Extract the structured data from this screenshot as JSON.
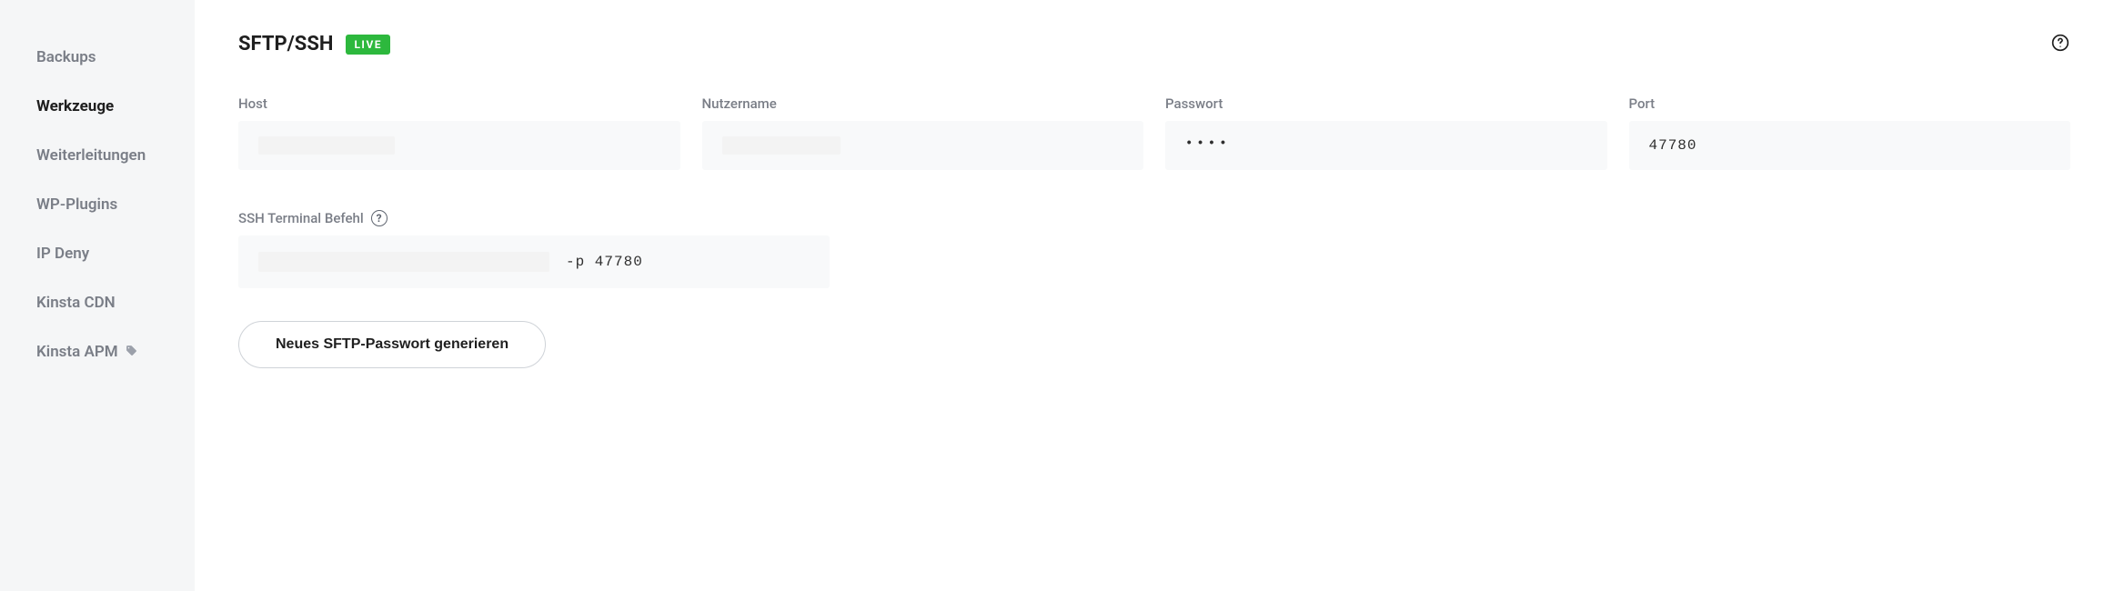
{
  "sidebar": {
    "items": [
      {
        "label": "Backups",
        "active": false
      },
      {
        "label": "Werkzeuge",
        "active": true
      },
      {
        "label": "Weiterleitungen",
        "active": false
      },
      {
        "label": "WP-Plugins",
        "active": false
      },
      {
        "label": "IP Deny",
        "active": false
      },
      {
        "label": "Kinsta CDN",
        "active": false
      },
      {
        "label": "Kinsta APM",
        "active": false,
        "tagged": true
      }
    ]
  },
  "header": {
    "title": "SFTP/SSH",
    "badge": "LIVE"
  },
  "fields": {
    "host": {
      "label": "Host",
      "value": ""
    },
    "username": {
      "label": "Nutzername",
      "value": ""
    },
    "password": {
      "label": "Passwort",
      "masked": "••••"
    },
    "port": {
      "label": "Port",
      "value": "47780"
    }
  },
  "ssh": {
    "label": "SSH Terminal Befehl",
    "suffix": "-p 47780"
  },
  "actions": {
    "regen_password": "Neues SFTP-Passwort generieren"
  }
}
